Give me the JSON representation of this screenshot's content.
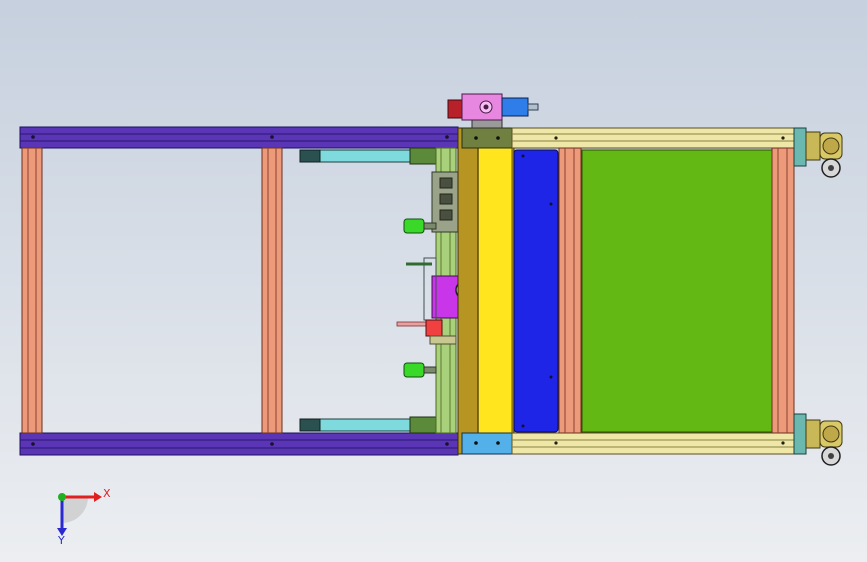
{
  "triad": {
    "x_label": "X",
    "y_label": "Y",
    "x_color": "#e02020",
    "y_color": "#2a2ad0",
    "origin_color": "#20b020"
  },
  "colors": {
    "background_top": "#c6d0de",
    "background_bottom": "#eceef1",
    "frame_rail": "#5a35b5",
    "frame_post": "#ed9a7a",
    "conveyor_belt": "#64b814",
    "conveyor_rail": "#efe7a8",
    "yellow_plate": "#ffe51e",
    "blue_plate": "#1e25e6",
    "magenta_block": "#c935e8",
    "cyan_cylinder": "#7fdadd",
    "green_knob": "#39d829",
    "olive_plate": "#b69522"
  }
}
